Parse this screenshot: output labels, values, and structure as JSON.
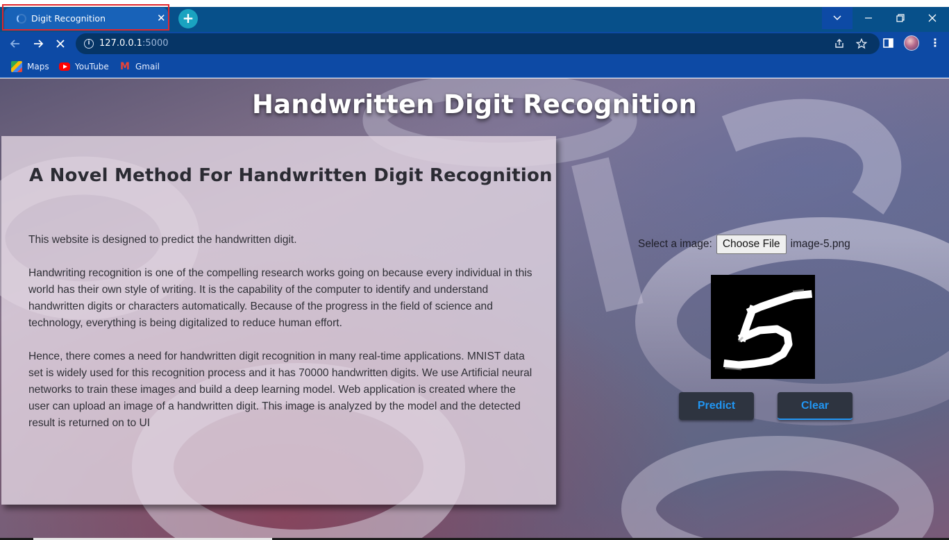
{
  "browser": {
    "tab": {
      "title": "Digit Recognition",
      "close_glyph": "✕"
    },
    "new_tab_glyph": "+",
    "tab_search_glyph": "⌄",
    "window_controls": {
      "minimize": "—",
      "restore": "❐",
      "close": "✕"
    },
    "nav": {
      "back": "←",
      "forward": "→",
      "stop": "✕"
    },
    "address": {
      "host": "127.0.0.1",
      "port": ":5000"
    },
    "omnibox_icons": {
      "share": "⇪",
      "bookmark_star": "☆"
    },
    "menu_glyph": "⋮",
    "bookmarks": [
      {
        "label": "Maps",
        "icon": "maps-icon"
      },
      {
        "label": "YouTube",
        "icon": "youtube-icon"
      },
      {
        "label": "Gmail",
        "icon": "gmail-icon"
      }
    ],
    "colors": {
      "tabstrip": "#07508a",
      "toolbar": "#0d4aa5",
      "tab_highlight": "#e1262c"
    }
  },
  "page": {
    "title": "Handwritten Digit Recognition",
    "card": {
      "heading": "A Novel Method For Handwritten Digit Recognition",
      "paragraphs": [
        "This website is designed to predict the handwritten digit.",
        "Handwriting recognition is one of the compelling research works going on because every individual in this world has their own style of writing. It is the capability of the computer to identify and understand handwritten digits or characters automatically. Because of the progress in the field of science and technology, everything is being digitalized to reduce human effort.",
        "Hence, there comes a need for handwritten digit recognition in many real-time applications. MNIST data set is widely used for this recognition process and it has 70000 handwritten digits. We use Artificial neural networks to train these images and build a deep learning model. Web application is created where the user can upload an image of a handwritten digit. This image is analyzed by the model and the detected result is returned on to UI"
      ]
    },
    "upload": {
      "label": "Select a image:",
      "button": "Choose File",
      "filename": "image-5.png"
    },
    "preview": {
      "depicted_digit": "5"
    },
    "buttons": {
      "predict": "Predict",
      "clear": "Clear"
    },
    "colors": {
      "button_bg": "#2e3440",
      "button_text": "#2196f3"
    }
  }
}
